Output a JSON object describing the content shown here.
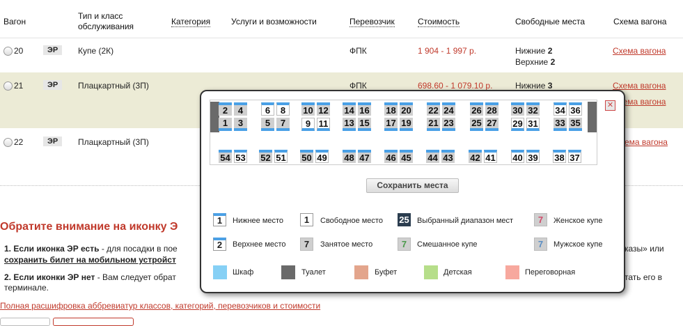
{
  "headers": {
    "car": "Вагон",
    "type_line1": "Тип и класс",
    "type_line2": "обслуживания",
    "category": "Категория",
    "services": "Услуги и возможности",
    "carrier": "Перевозчик",
    "cost": "Стоимость",
    "free_seats": "Свободные места",
    "scheme": "Схема вагона"
  },
  "rows": [
    {
      "car": "20",
      "badge": "ЭР",
      "type": "Купе (2К)",
      "carrier": "ФПК",
      "price": "1 904 - 1 997 р.",
      "lower": "Нижние",
      "lower_n": "2",
      "upper": "Верхние",
      "upper_n": "2",
      "scheme": "Схема вагона"
    },
    {
      "car": "21",
      "badge": "ЭР",
      "type": "Плацкартный (3П)",
      "carrier": "ФПК",
      "price": "698.60 - 1 079.10 р.",
      "lower": "Нижние",
      "lower_n": "3",
      "scheme": "Схема вагона",
      "scheme2": "Схема вагона"
    },
    {
      "car": "22",
      "badge": "ЭР",
      "type": "Плацкартный (3П)",
      "scheme_partial": "ема вагона"
    }
  ],
  "notice": {
    "title": "Обратите внимание на иконку",
    "title_tail": "Э",
    "p1_bold": "1. Если иконка ЭР есть",
    "p1_text": " - для посадки в пое",
    "p1_link": "сохранить билет на мобильном устройст",
    "p1_right": "казы» или",
    "p2_bold": "2. Если иконки ЭР нет",
    "p2_text": " - Вам следует обрат",
    "p2_right": "тать его в",
    "p2_line2": "терминале.",
    "footer_link": "Полная расшифровка аббревиатур классов, категорий, перевозчиков и стоимости"
  },
  "popup": {
    "close_label": "✕",
    "save_button": "Сохранить места",
    "upper_compartments": [
      [
        {
          "n": "2",
          "s": "occ"
        },
        {
          "n": "4",
          "s": "occ"
        },
        {
          "n": "1",
          "s": "occ"
        },
        {
          "n": "3",
          "s": "occ"
        }
      ],
      [
        {
          "n": "6",
          "s": "free"
        },
        {
          "n": "8",
          "s": "free"
        },
        {
          "n": "5",
          "s": "occ"
        },
        {
          "n": "7",
          "s": "occ"
        }
      ],
      [
        {
          "n": "10",
          "s": "occ"
        },
        {
          "n": "12",
          "s": "occ"
        },
        {
          "n": "9",
          "s": "free"
        },
        {
          "n": "11",
          "s": "free"
        }
      ],
      [
        {
          "n": "14",
          "s": "occ"
        },
        {
          "n": "16",
          "s": "occ"
        },
        {
          "n": "13",
          "s": "occ"
        },
        {
          "n": "15",
          "s": "occ"
        }
      ],
      [
        {
          "n": "18",
          "s": "occ"
        },
        {
          "n": "20",
          "s": "occ"
        },
        {
          "n": "17",
          "s": "occ"
        },
        {
          "n": "19",
          "s": "occ"
        }
      ],
      [
        {
          "n": "22",
          "s": "occ"
        },
        {
          "n": "24",
          "s": "occ"
        },
        {
          "n": "21",
          "s": "occ"
        },
        {
          "n": "23",
          "s": "occ"
        }
      ],
      [
        {
          "n": "26",
          "s": "occ"
        },
        {
          "n": "28",
          "s": "occ"
        },
        {
          "n": "25",
          "s": "occ"
        },
        {
          "n": "27",
          "s": "occ"
        }
      ],
      [
        {
          "n": "30",
          "s": "occ"
        },
        {
          "n": "32",
          "s": "occ"
        },
        {
          "n": "29",
          "s": "free"
        },
        {
          "n": "31",
          "s": "free"
        }
      ],
      [
        {
          "n": "34",
          "s": "free"
        },
        {
          "n": "36",
          "s": "free"
        },
        {
          "n": "33",
          "s": "occ"
        },
        {
          "n": "35",
          "s": "occ"
        }
      ]
    ],
    "side_pairs": [
      [
        {
          "n": "54",
          "s": "occ"
        },
        {
          "n": "53",
          "s": "free"
        }
      ],
      [
        {
          "n": "52",
          "s": "occ"
        },
        {
          "n": "51",
          "s": "free"
        }
      ],
      [
        {
          "n": "50",
          "s": "occ"
        },
        {
          "n": "49",
          "s": "free"
        }
      ],
      [
        {
          "n": "48",
          "s": "occ"
        },
        {
          "n": "47",
          "s": "occ"
        }
      ],
      [
        {
          "n": "46",
          "s": "occ"
        },
        {
          "n": "45",
          "s": "occ"
        }
      ],
      [
        {
          "n": "44",
          "s": "occ"
        },
        {
          "n": "43",
          "s": "occ"
        }
      ],
      [
        {
          "n": "42",
          "s": "occ"
        },
        {
          "n": "41",
          "s": "free"
        }
      ],
      [
        {
          "n": "40",
          "s": "free"
        },
        {
          "n": "39",
          "s": "free"
        }
      ],
      [
        {
          "n": "38",
          "s": "free"
        },
        {
          "n": "37",
          "s": "free"
        }
      ]
    ],
    "legend": {
      "lower_seat": {
        "num": "1",
        "label": "Нижнее место"
      },
      "upper_seat": {
        "num": "2",
        "label": "Верхнее место"
      },
      "free_seat": {
        "num": "1",
        "label": "Свободное место"
      },
      "occupied_seat": {
        "num": "7",
        "label": "Занятое место"
      },
      "selected_range": {
        "num": "25",
        "label": "Выбранный диапазон мест"
      },
      "mixed": {
        "num": "7",
        "label": "Смешанное купе"
      },
      "female": {
        "num": "7",
        "label": "Женское купе"
      },
      "male": {
        "num": "7",
        "label": "Мужское купе"
      },
      "wardrobe": "Шкаф",
      "toilet": "Туалет",
      "buffet": "Буфет",
      "kids": "Детская",
      "meeting": "Переговорная"
    },
    "colors": {
      "seat_blue": "#4aa0e6",
      "occupied": "#cfcfcf",
      "selected": "#2b3d4f",
      "wardrobe": "#86d0f5",
      "toilet": "#6a6a6a",
      "buffet": "#e3a58c",
      "kids": "#b6de8a",
      "meeting": "#f7a89e",
      "female": "#d04b6a",
      "male": "#5a8ec4",
      "mixed": "#4a9a4a",
      "accent_red": "#c0392b"
    }
  }
}
